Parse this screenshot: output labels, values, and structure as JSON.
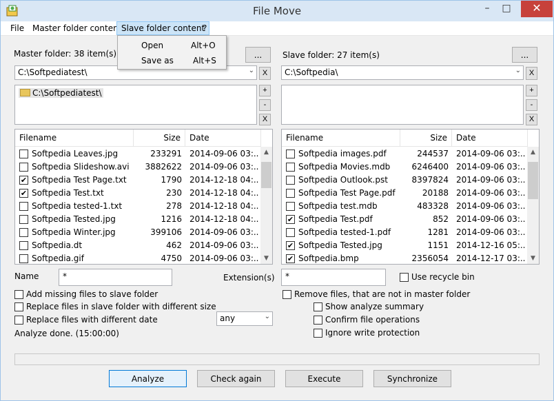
{
  "window": {
    "title": "File Move",
    "minimize_glyph": "–",
    "maximize_glyph": "□",
    "close_glyph": "✕",
    "icon": "app-icon"
  },
  "menubar": {
    "items": [
      "File",
      "Master folder content",
      "Slave folder content",
      "?"
    ]
  },
  "dropdown": {
    "items": [
      {
        "label": "Open",
        "shortcut": "Alt+O"
      },
      {
        "label": "Save as",
        "shortcut": "Alt+S"
      }
    ]
  },
  "master": {
    "label": "Master folder: 38 item(s)",
    "browse_label": "...",
    "path": "C:\\Softpediatest\\",
    "clear_label": "X",
    "add_label": "+",
    "remove_label": "-",
    "delete_label": "X",
    "folder": "C:\\Softpediatest\\",
    "columns": [
      "Filename",
      "Size",
      "Date"
    ],
    "rows": [
      {
        "checked": false,
        "name": "Softpedia Leaves.jpg",
        "size": "233291",
        "date": "2014-09-06 03:..."
      },
      {
        "checked": false,
        "name": "Softpedia Slideshow.avi",
        "size": "3882622",
        "date": "2014-09-06 03:..."
      },
      {
        "checked": true,
        "name": "Softpedia Test Page.txt",
        "size": "1790",
        "date": "2014-12-18 04:..."
      },
      {
        "checked": true,
        "name": "Softpedia Test.txt",
        "size": "230",
        "date": "2014-12-18 04:..."
      },
      {
        "checked": false,
        "name": "Softpedia tested-1.txt",
        "size": "278",
        "date": "2014-12-18 04:..."
      },
      {
        "checked": false,
        "name": "Softpedia Tested.jpg",
        "size": "1216",
        "date": "2014-12-18 04:..."
      },
      {
        "checked": false,
        "name": "Softpedia Winter.jpg",
        "size": "399106",
        "date": "2014-09-06 03:..."
      },
      {
        "checked": false,
        "name": "Softpedia.dt",
        "size": "462",
        "date": "2014-09-06 03:..."
      },
      {
        "checked": false,
        "name": "Softpedia.gif",
        "size": "4750",
        "date": "2014-09-06 03:..."
      }
    ]
  },
  "slave": {
    "label": "Slave folder: 27 item(s)",
    "browse_label": "...",
    "path": "C:\\Softpedia\\",
    "clear_label": "X",
    "add_label": "+",
    "remove_label": "-",
    "delete_label": "X",
    "columns": [
      "Filename",
      "Size",
      "Date"
    ],
    "rows": [
      {
        "checked": false,
        "name": "Softpedia images.pdf",
        "size": "244537",
        "date": "2014-09-06 03:..."
      },
      {
        "checked": false,
        "name": "Softpedia Movies.mdb",
        "size": "6246400",
        "date": "2014-09-06 03:..."
      },
      {
        "checked": false,
        "name": "Softpedia Outlook.pst",
        "size": "8397824",
        "date": "2014-09-06 03:..."
      },
      {
        "checked": false,
        "name": "Softpedia Test Page.pdf",
        "size": "20188",
        "date": "2014-09-06 03:..."
      },
      {
        "checked": false,
        "name": "Softpedia test.mdb",
        "size": "483328",
        "date": "2014-09-06 03:..."
      },
      {
        "checked": true,
        "name": "Softpedia Test.pdf",
        "size": "852",
        "date": "2014-09-06 03:..."
      },
      {
        "checked": false,
        "name": "Softpedia tested-1.pdf",
        "size": "1281",
        "date": "2014-09-06 03:..."
      },
      {
        "checked": true,
        "name": "Softpedia Tested.jpg",
        "size": "1151",
        "date": "2014-12-16 05:..."
      },
      {
        "checked": true,
        "name": "Softpedia.bmp",
        "size": "2356054",
        "date": "2014-12-17 03:..."
      }
    ]
  },
  "filters": {
    "name_label": "Name",
    "name_value": "*",
    "extension_label": "Extension(s)",
    "extension_value": "*",
    "recycle_label": "Use recycle bin",
    "recycle_checked": false,
    "date_option": "any"
  },
  "options": {
    "add_missing": {
      "label": "Add missing files to slave folder",
      "checked": false
    },
    "replace_size": {
      "label": "Replace files in slave folder with different size",
      "checked": false
    },
    "replace_date": {
      "label": "Replace files with different date",
      "checked": false
    },
    "remove_files": {
      "label": "Remove files, that are not in master folder",
      "checked": false
    },
    "show_summary": {
      "label": "Show analyze summary",
      "checked": false
    },
    "confirm_ops": {
      "label": "Confirm file operations",
      "checked": false
    },
    "ignore_protect": {
      "label": "Ignore write protection",
      "checked": false
    }
  },
  "status": "Analyze done. (15:00:00)",
  "buttons": {
    "analyze": "Analyze",
    "check_again": "Check again",
    "execute": "Execute",
    "synchronize": "Synchronize"
  },
  "icons": {
    "combo_arrow": "⌵",
    "scroll_up": "▲",
    "scroll_down": "▼",
    "check": "✔"
  }
}
